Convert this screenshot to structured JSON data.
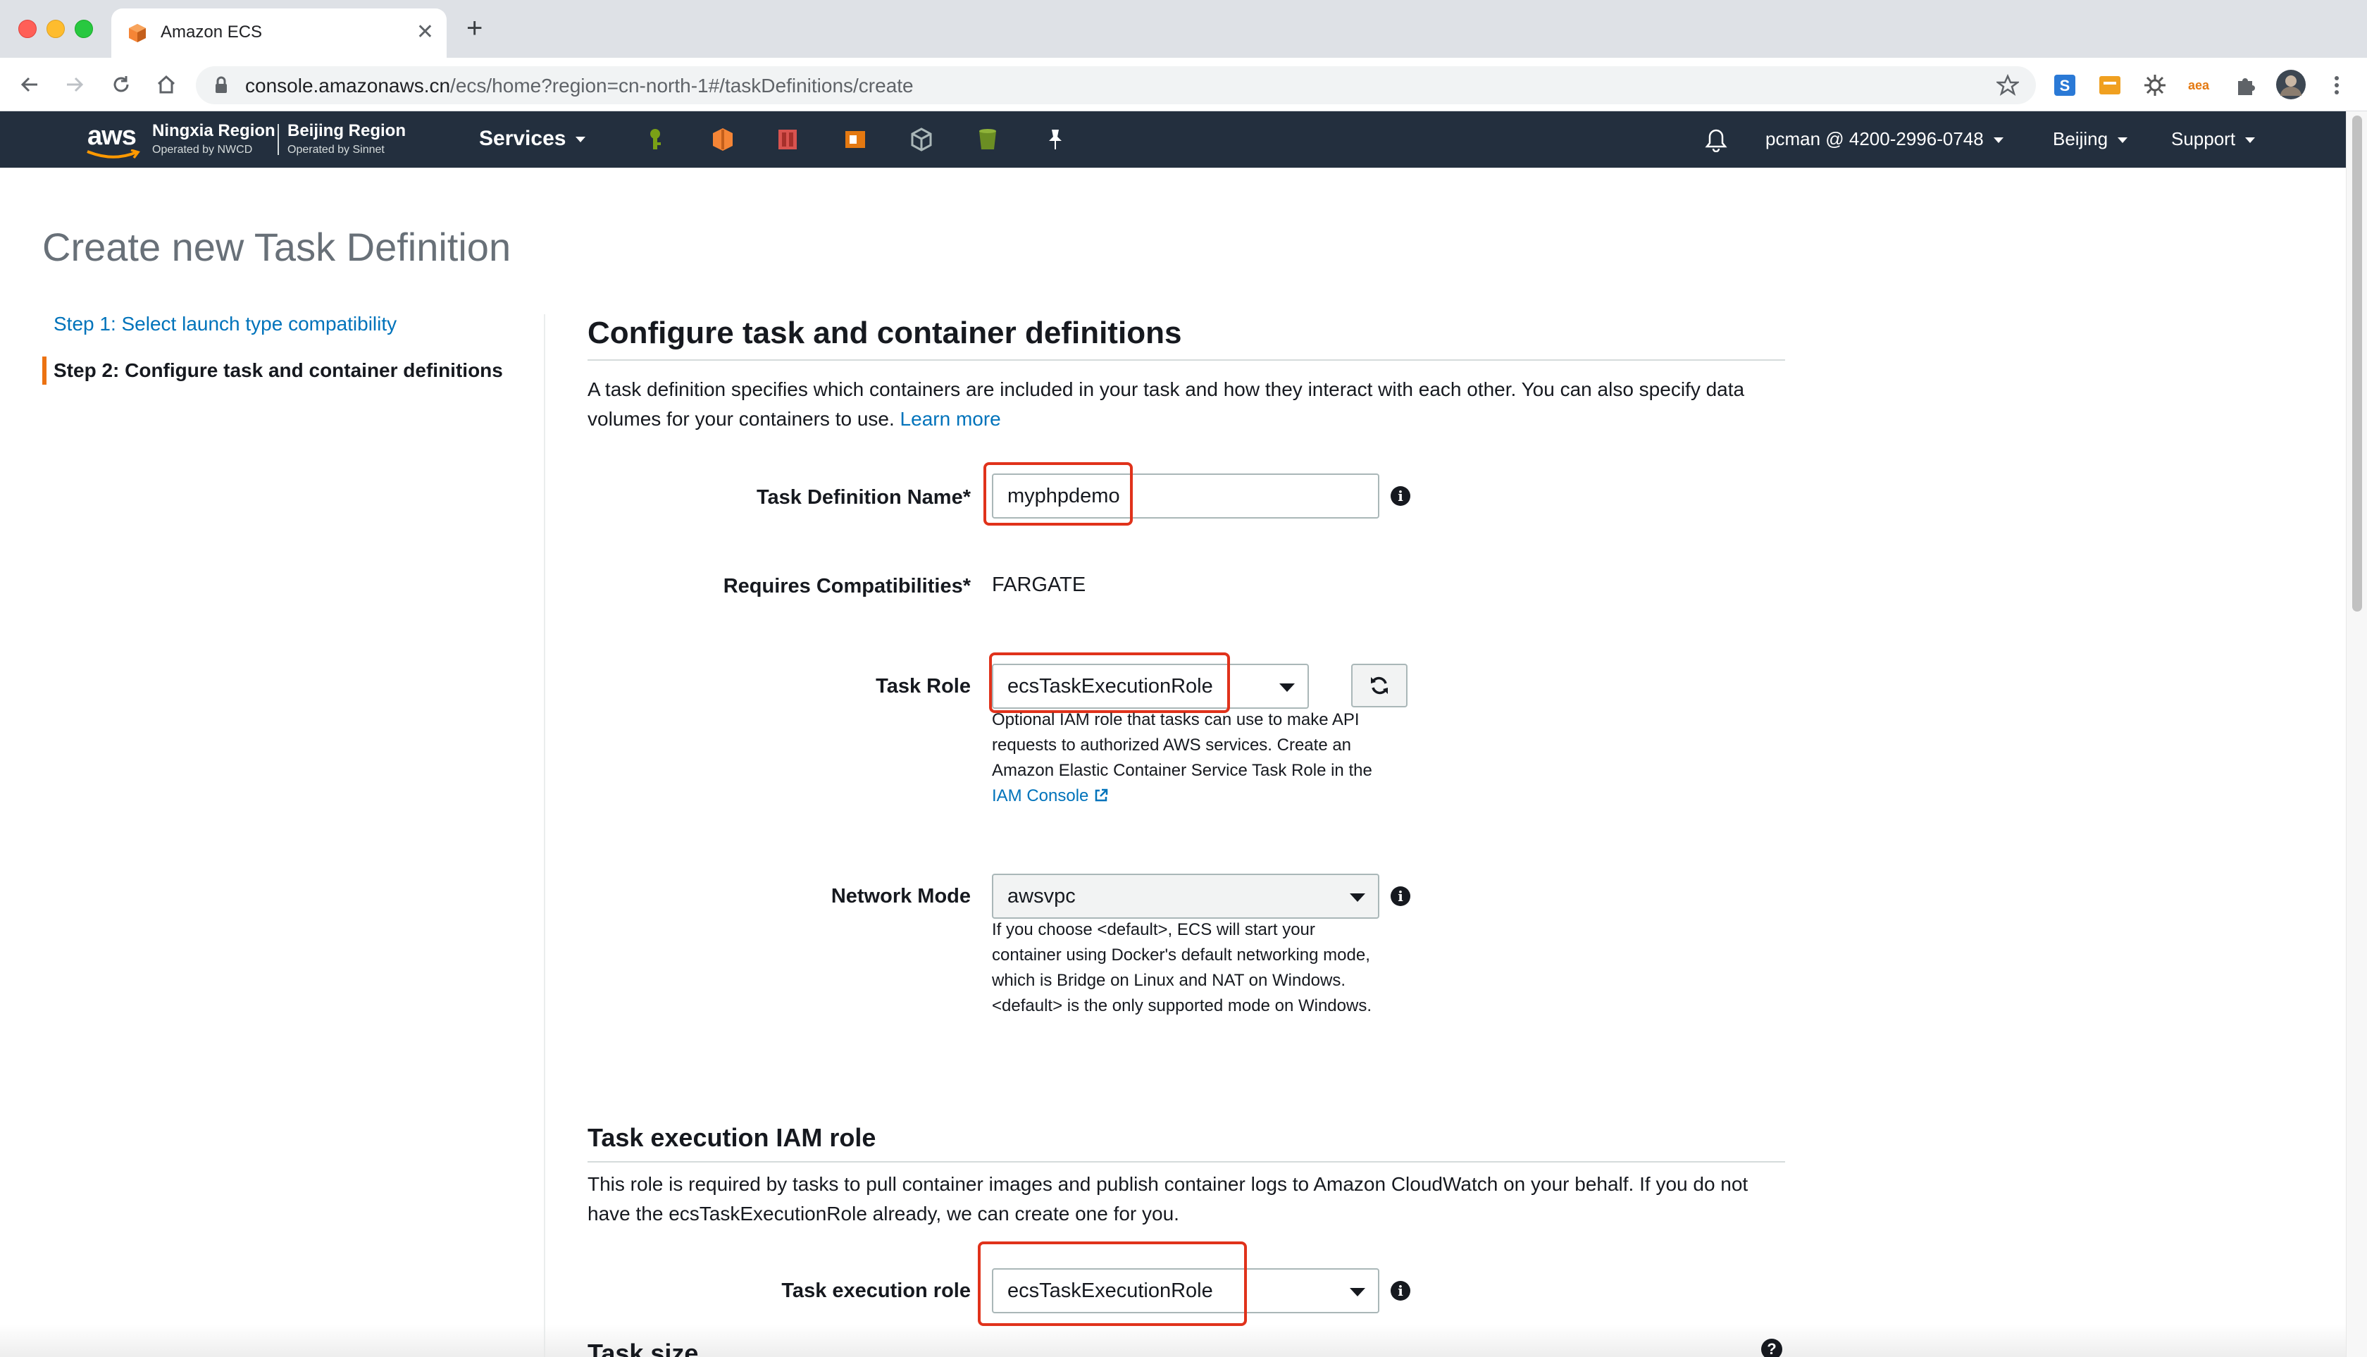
{
  "browser": {
    "tab_title": "Amazon ECS",
    "tab_close": "✕",
    "new_tab": "+",
    "url_host": "console.amazonaws.cn",
    "url_path": "/ecs/home?region=cn-north-1#/taskDefinitions/create",
    "ext_label_aea": "aea"
  },
  "awsnav": {
    "logo": "aws",
    "region1_title": "Ningxia Region",
    "region1_sub": "Operated by NWCD",
    "region2_title": "Beijing Region",
    "region2_sub": "Operated by Sinnet",
    "services": "Services",
    "account": "pcman @ 4200-2996-0748",
    "region": "Beijing",
    "support": "Support"
  },
  "page": {
    "title": "Create new Task Definition",
    "steps": [
      "Step 1: Select launch type compatibility",
      "Step 2: Configure task and container definitions"
    ]
  },
  "section": {
    "title": "Configure task and container definitions",
    "desc": "A task definition specifies which containers are included in your task and how they interact with each other. You can also specify data volumes for your containers to use.",
    "learn_more": "Learn more"
  },
  "form": {
    "task_def_name_label": "Task Definition Name*",
    "task_def_name_value": "myphpdemo",
    "requires_compat_label": "Requires Compatibilities*",
    "requires_compat_value": "FARGATE",
    "task_role_label": "Task Role",
    "task_role_value": "ecsTaskExecutionRole",
    "task_role_help": "Optional IAM role that tasks can use to make API requests to authorized AWS services. Create an Amazon Elastic Container Service Task Role in the",
    "iam_console": "IAM Console",
    "network_mode_label": "Network Mode",
    "network_mode_value": "awsvpc",
    "network_mode_help": "If you choose <default>, ECS will start your container using Docker's default networking mode, which is Bridge on Linux and NAT on Windows. <default> is the only supported mode on Windows."
  },
  "exec_role": {
    "title": "Task execution IAM role",
    "desc": "This role is required by tasks to pull container images and publish container logs to Amazon CloudWatch on your behalf. If you do not have the ecsTaskExecutionRole already, we can create one for you.",
    "label": "Task execution role",
    "value": "ecsTaskExecutionRole"
  },
  "task_size": {
    "title": "Task size"
  },
  "icons": {
    "info": "i",
    "question": "?"
  },
  "colors": {
    "aws_nav": "#232f3e",
    "link": "#0073bb",
    "step_accent": "#ec7211",
    "highlight": "#e0321b"
  }
}
